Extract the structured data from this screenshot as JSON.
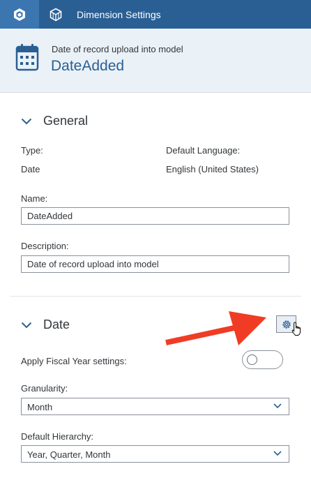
{
  "topbar": {
    "home_icon": "cube-logo-icon",
    "tab_icon": "cube-outline-icon",
    "tab_title": "Dimension Settings"
  },
  "header": {
    "icon": "calendar-icon",
    "subtitle": "Date of record upload into model",
    "title": "DateAdded"
  },
  "general": {
    "heading": "General",
    "type_label": "Type:",
    "type_value": "Date",
    "language_label": "Default Language:",
    "language_value": "English (United States)",
    "name_label": "Name:",
    "name_value": "DateAdded",
    "description_label": "Description:",
    "description_value": "Date of record upload into model"
  },
  "date": {
    "heading": "Date",
    "fiscal_label": "Apply Fiscal Year settings:",
    "fiscal_enabled": false,
    "granularity_label": "Granularity:",
    "granularity_value": "Month",
    "hierarchy_label": "Default Hierarchy:",
    "hierarchy_value": "Year, Quarter, Month"
  },
  "colors": {
    "topbar": "#2a5f94",
    "active_tab": "#3b76b1",
    "header_bg": "#eaf1f7",
    "title_blue": "#2a5f94",
    "annotation_arrow": "#f03c24"
  }
}
